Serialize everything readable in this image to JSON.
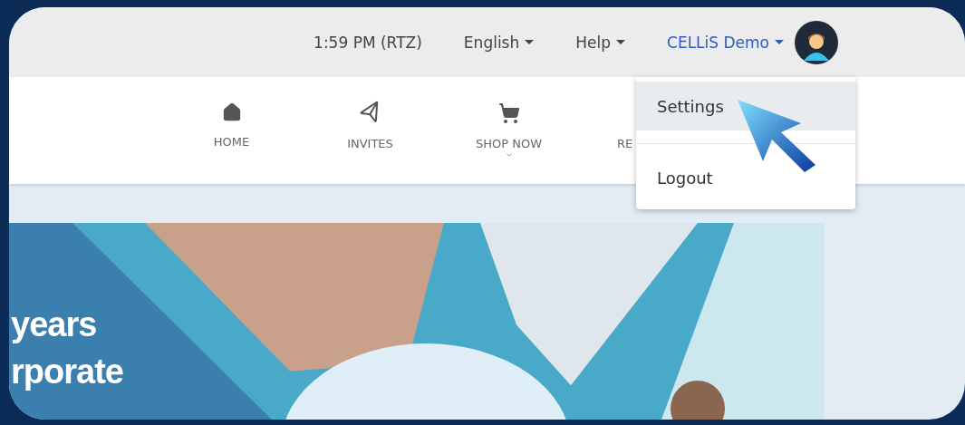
{
  "top_bar": {
    "time": "1:59 PM (RTZ)",
    "menus": [
      {
        "label": "English"
      },
      {
        "label": "Help"
      }
    ],
    "user": {
      "name": "CELLiS Demo"
    }
  },
  "nav": [
    {
      "label": "HOME",
      "kind": "home"
    },
    {
      "label": "INVITES",
      "kind": "send"
    },
    {
      "label": "SHOP NOW",
      "kind": "cart",
      "has_submenu": true
    },
    {
      "label": "RE",
      "kind": "none"
    }
  ],
  "user_menu": {
    "items": [
      {
        "label": "Settings",
        "selected": true
      },
      {
        "label": "Logout",
        "selected": false
      }
    ]
  },
  "banner": {
    "lines": [
      "years",
      "rporate"
    ]
  }
}
